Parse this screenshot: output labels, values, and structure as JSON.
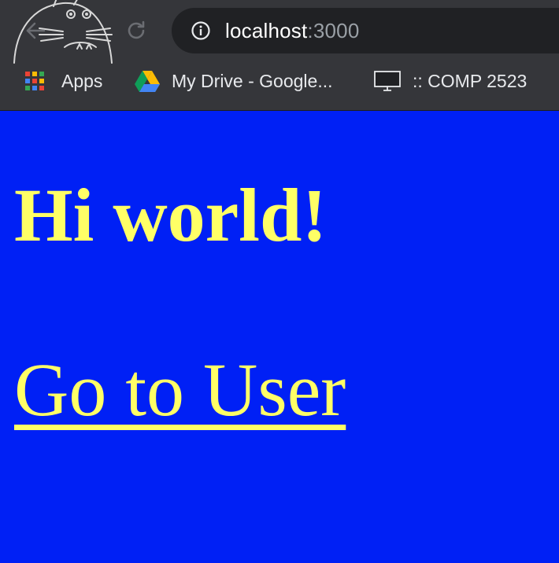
{
  "browser": {
    "url_host": "localhost",
    "url_port": ":3000",
    "icons": {
      "back": "arrow-left-icon",
      "reload": "reload-icon",
      "site_info": "info-icon",
      "theme_art": "totoro-icon"
    },
    "bookmarks": [
      {
        "label": "Apps",
        "icon": "apps-grid-icon"
      },
      {
        "label": "My Drive - Google...",
        "icon": "google-drive-icon"
      },
      {
        "label": ":: COMP 2523",
        "icon": "monitor-icon"
      }
    ]
  },
  "page": {
    "heading": "Hi world!",
    "link_label": "Go to User",
    "colors": {
      "background": "#0020f5",
      "text": "#ffff66"
    }
  }
}
